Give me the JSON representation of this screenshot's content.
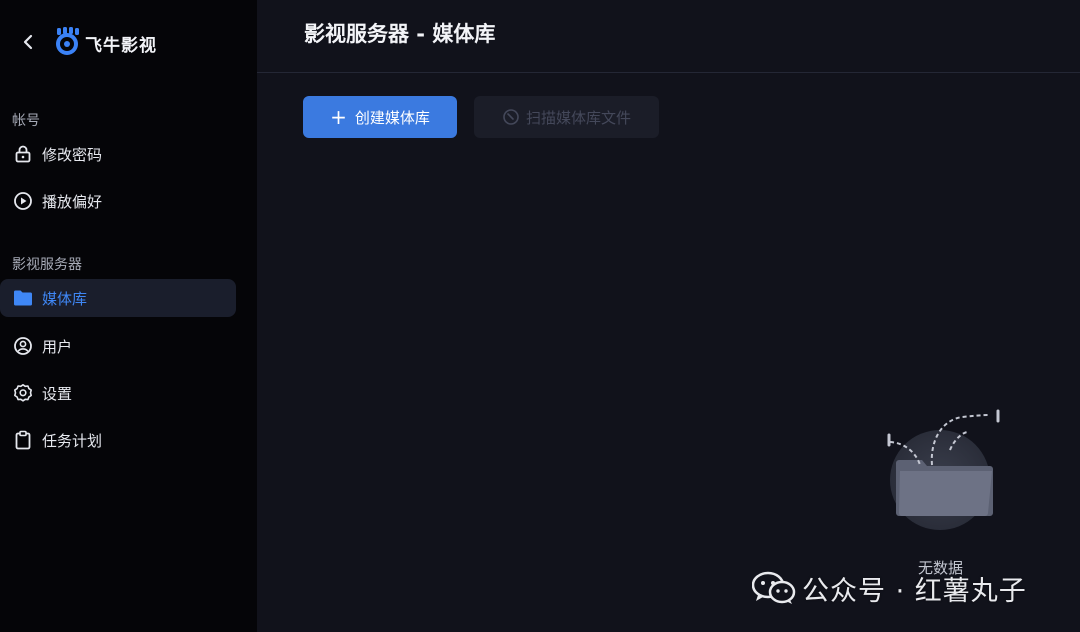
{
  "sidebar": {
    "brand": "飞牛影视",
    "sections": [
      {
        "label": "帐号",
        "items": [
          {
            "label": "修改密码",
            "icon": "lock-icon"
          },
          {
            "label": "播放偏好",
            "icon": "play-circle-icon"
          }
        ]
      },
      {
        "label": "影视服务器",
        "items": [
          {
            "label": "媒体库",
            "icon": "folder-icon",
            "active": true
          },
          {
            "label": "用户",
            "icon": "user-circle-icon"
          },
          {
            "label": "设置",
            "icon": "gear-icon"
          },
          {
            "label": "任务计划",
            "icon": "clipboard-icon"
          }
        ]
      }
    ]
  },
  "main": {
    "title": "影视服务器 - 媒体库",
    "create_button": "创建媒体库",
    "scan_button": "扫描媒体库文件",
    "empty_text": "无数据"
  },
  "watermark": {
    "text": "公众号 · 红薯丸子"
  },
  "colors": {
    "accent": "#3b7ae0",
    "active_text": "#3f87f5",
    "sidebar_bg": "#050508",
    "main_bg": "#11121b"
  }
}
